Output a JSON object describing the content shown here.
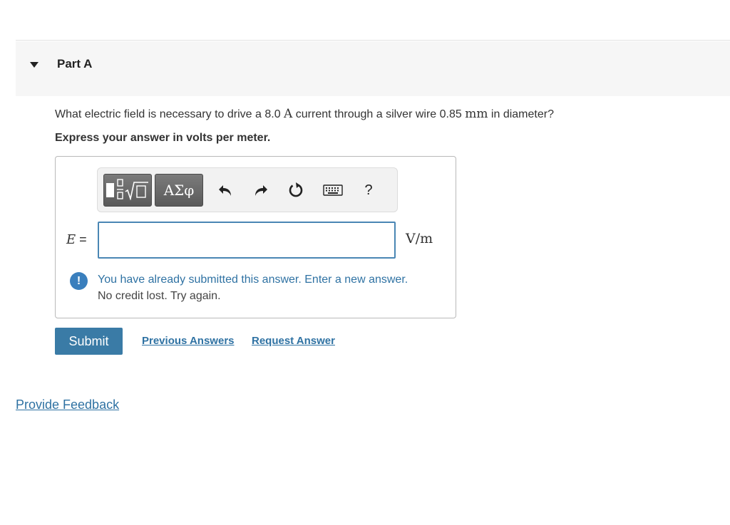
{
  "part": {
    "title": "Part A"
  },
  "question": {
    "text_before": "What electric field is necessary to drive a ",
    "current_value": "8.0",
    "current_unit": "A",
    "text_middle": " current through a silver wire ",
    "diameter_value": "0.85",
    "diameter_unit": "mm",
    "text_after": " in diameter?"
  },
  "instruction": "Express your answer in volts per meter.",
  "toolbar": {
    "templates_icon": "fraction-root-template-icon",
    "symbols_label": "ΑΣφ",
    "undo_icon": "undo-arrow-icon",
    "redo_icon": "redo-arrow-icon",
    "reset_icon": "reset-icon",
    "keyboard_icon": "keyboard-icon",
    "help_label": "?"
  },
  "answer": {
    "variable": "E",
    "equals": "=",
    "value": "",
    "unit": "V/m"
  },
  "feedback": {
    "icon": "!",
    "line1": "You have already submitted this answer. Enter a new answer.",
    "line2": "No credit lost. Try again."
  },
  "actions": {
    "submit": "Submit",
    "previous_answers": "Previous Answers",
    "request_answer": "Request Answer"
  },
  "provide_feedback": "Provide Feedback",
  "colors": {
    "accent": "#3a7ba6",
    "link": "#2f72a3",
    "input_border": "#4a86b4",
    "header_bg": "#f6f6f6"
  }
}
